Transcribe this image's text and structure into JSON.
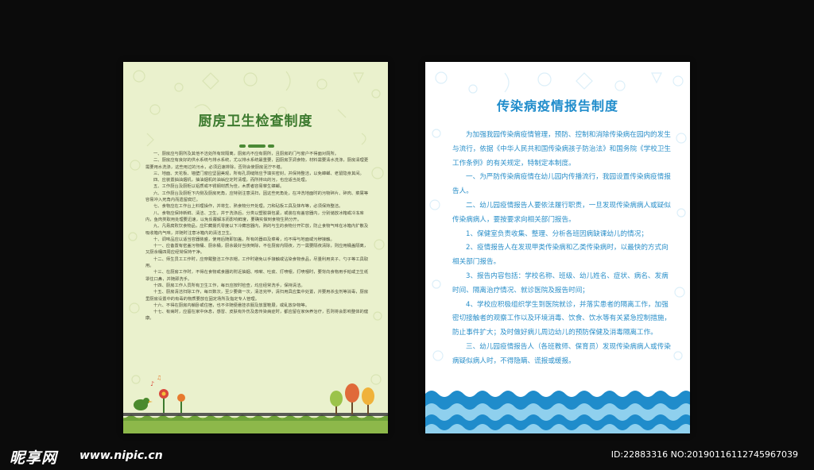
{
  "left_poster": {
    "title": "厨房卫生检查制度",
    "paragraphs": [
      "一、厨房应与厕所及其他不洁处所有效隔离，厨房内不应有厕所，且厨房的门与窗户不得面对厕所。",
      "二、厨房应有良好的供水系统与排水系统，尤以排水系统最重要，因厨房烹调食物，材料需要清水洗涤，厨房清理更需要用水洗涤，这些用过的污水，必须迅速排除，否则会使厨房泥泞不堪。",
      "三、地面、天花板、墙壁门窗应坚固美观，所有孔洞缝隙应予填实密封，并保持整洁，以免蟑螂、老鼠隐身其间。",
      "四、应装置抽油烟机，抽油烟机的油垢应定时清理，而所排出的污，也应适当处理。",
      "五、工作厨台及厨柜以铝质或不锈钢材质为佳，木质者容易孳生蟑螂。",
      "六、工作厨台及厨柜下内侧及厨房死角，应特别注意清扫，因这些死角处，在冲洗地面时的污物碎片、碎肉、菜屑等容易冲入死角内而遗留腐烂。",
      "七、食物应在工作台上料理操作，并将生、熟食物分开处理。刀和砧板工具及抹布等，必须保持整洁。",
      "八、食物应保持新鲜、清洁、卫生，并于洗涤后，分类以塑胶袋包紧，或装在有盖容器内，分别储放冰箱或冷冻库内，鱼肉类取用处理要迅速，以免反覆解冻而影响鲜度，要确实做到食物生熟分开。",
      "九、凡易腐败饮食物品，应贮藏摄氏零度以下冷藏容器内，熟的与生的食物分开贮放，防止食物气味在冰箱内扩散及吸收箱内气味，并随时注意冰箱内的清洁卫生。",
      "十、调味品应以适当容器装盛，使用后随即加盖，所有的器皿及菜肴，均不得与地面或污秽接触。",
      "十一、应备置有密盖污物桶、厨余桶，厨余最好当夜倒除，不在厨房内隔夜，万一需要隔夜清除，则应用桶盖隔离，又厨余桶四周应经常保持干净。",
      "十二、师生员工工作时，应穿戴整洁工作衣帽，工作时避免以手接触或沾染食物食品，尽量利用夹子、勺子等工具取用。",
      "十三、在厨房工作时，不得在食物或食器的附近抽烟、咳嗽、吐痰、打喷嚏，打喷嚏时，要背向食物用手帕或卫生纸罩住口鼻，并随即洗手。",
      "十四、厨房工作人员所有卫生工作，每日应按时检查，均应经常洗手，保持清洁。",
      "十五、厨房清洁扫除工作，每日数次，至少要做一次，清洁完毕，清扫用具应集中处置，并要用杀虫剂等消毒，厨房里厨房设置中的有毒的物质要放在固定场所及指定专人管理。",
      "十六、不得在厨房内躺卧或住宿，也不许随便悬挂衣服及放置鞋屐，或乱放杂物等。",
      "十七、有病时，应留在家中休息，感冒、皮肤有外伤及患传染病症时，都应留在家休养治疗，否则将会影响整体的健康。"
    ]
  },
  "right_poster": {
    "title": "传染病疫情报告制度",
    "paragraphs": [
      "为加强我园传染病疫情管理，预防、控制和消除传染病在园内的发生与流行，依据《中华人民共和国传染病孩子防治法》和国务院《学校卫生工作条例》的有关规定，特制定本制度。",
      "一、为严防传染病疫情在幼儿园内传播流行，我园设置传染病疫情报告人。",
      "二、幼儿园疫情报告人要依法履行职责，一旦发现传染病病人或疑似传染病病人，要按要求向相关部门报告。",
      "1、保健室负责收集、整理、分析各班因病缺课幼儿的情况；",
      "2、疫情报告人在发现甲类传染病和乙类传染病时，以最快的方式向相关部门报告。",
      "3、报告内容包括：学校名称、班级、幼儿姓名、症状、病名、发病时间、隔离治疗情况、就诊医院及报告时间；",
      "4、学校应积极组织学生到医院就诊，并落实患者的隔离工作，加强密切接触者的观察工作以及环境消毒、饮食、饮水等有关紧急控制措施，防止事件扩大；及时做好病儿周边幼儿的预防保健及消毒隔离工作。",
      "三、幼儿园疫情报告人（各班教师、保育员）发现传染病病人或传染病疑似病人时，不得隐瞒、谎报或缓报。"
    ]
  },
  "watermark": {
    "logo": "昵享网",
    "url": "www.nipic.cn",
    "id": "ID:22883316 NO:20190116112745967039"
  },
  "colors": {
    "background": "#0b0b0b",
    "left_paper": "#eaf1cd",
    "left_title": "#3c7a2e",
    "right_title": "#1f8ccb",
    "wave_dark": "#1f8ccb",
    "wave_light": "#8fd0ee"
  }
}
